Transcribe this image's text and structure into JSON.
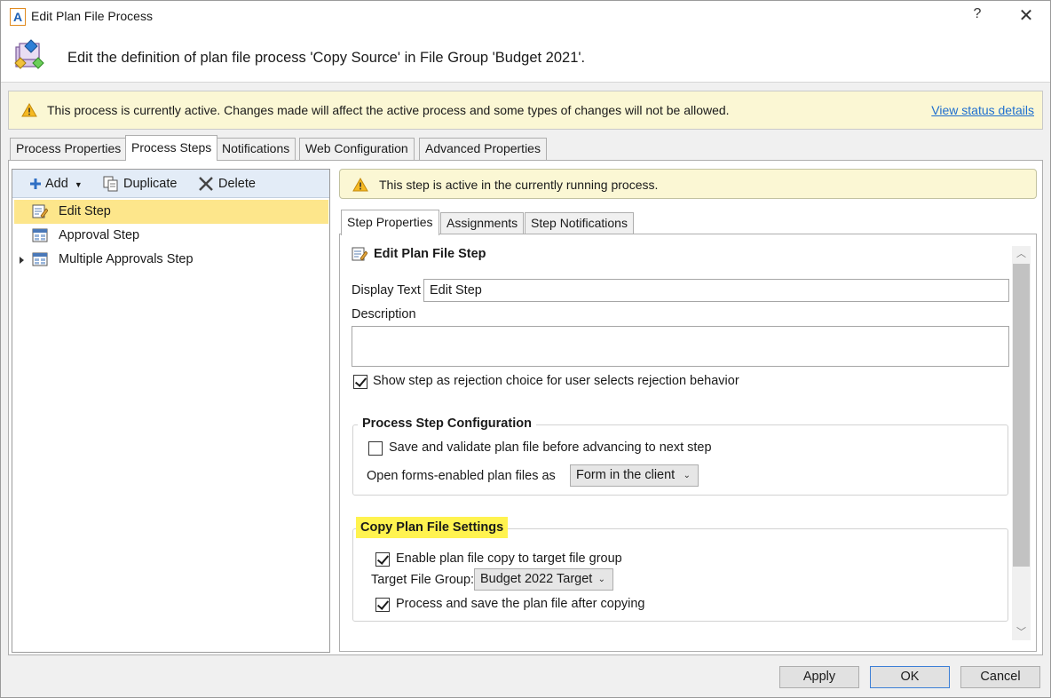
{
  "window": {
    "title": "Edit Plan File Process",
    "help_label": "?",
    "close_label": "✕"
  },
  "header": {
    "text": "Edit the definition of plan file process 'Copy Source' in File Group 'Budget 2021'."
  },
  "banner": {
    "text": "This process is currently active. Changes made will affect the active process and some types of changes will not be allowed.",
    "link": "View status details"
  },
  "tabs": [
    {
      "label": "Process Properties"
    },
    {
      "label": "Process Steps"
    },
    {
      "label": "Notifications"
    },
    {
      "label": "Web Configuration"
    },
    {
      "label": "Advanced Properties"
    }
  ],
  "toolbar": {
    "add_label": "Add",
    "duplicate_label": "Duplicate",
    "delete_label": "Delete"
  },
  "steps": [
    {
      "label": "Edit Step"
    },
    {
      "label": "Approval Step"
    },
    {
      "label": "Multiple Approvals Step"
    }
  ],
  "step_banner": {
    "text": "This step is active in the currently running process."
  },
  "step_tabs": [
    {
      "label": "Step Properties"
    },
    {
      "label": "Assignments"
    },
    {
      "label": "Step Notifications"
    }
  ],
  "step_properties": {
    "title": "Edit Plan File Step",
    "display_text_label": "Display Text",
    "display_text_value": "Edit Step",
    "description_label": "Description",
    "description_value": "",
    "rejection_label": "Show step as rejection choice for user selects rejection behavior",
    "rejection_checked": true
  },
  "process_step_config": {
    "title": "Process Step Configuration",
    "save_validate_label": "Save and validate plan file before advancing to next step",
    "save_validate_checked": false,
    "open_forms_label": "Open forms-enabled plan files as",
    "open_forms_value": "Form in the client"
  },
  "copy_settings": {
    "title": "Copy Plan File Settings",
    "enable_copy_label": "Enable plan file copy to target file group",
    "enable_copy_checked": true,
    "target_group_label": "Target File Group:",
    "target_group_value": "Budget 2022 Target",
    "process_save_label": "Process and save the plan file after copying",
    "process_save_checked": true
  },
  "buttons": {
    "apply": "Apply",
    "ok": "OK",
    "cancel": "Cancel"
  },
  "colors": {
    "accent": "#1f6fcf",
    "banner_bg": "#fbf7d4",
    "selected_row": "#fde68b",
    "highlight": "#fff34f"
  }
}
